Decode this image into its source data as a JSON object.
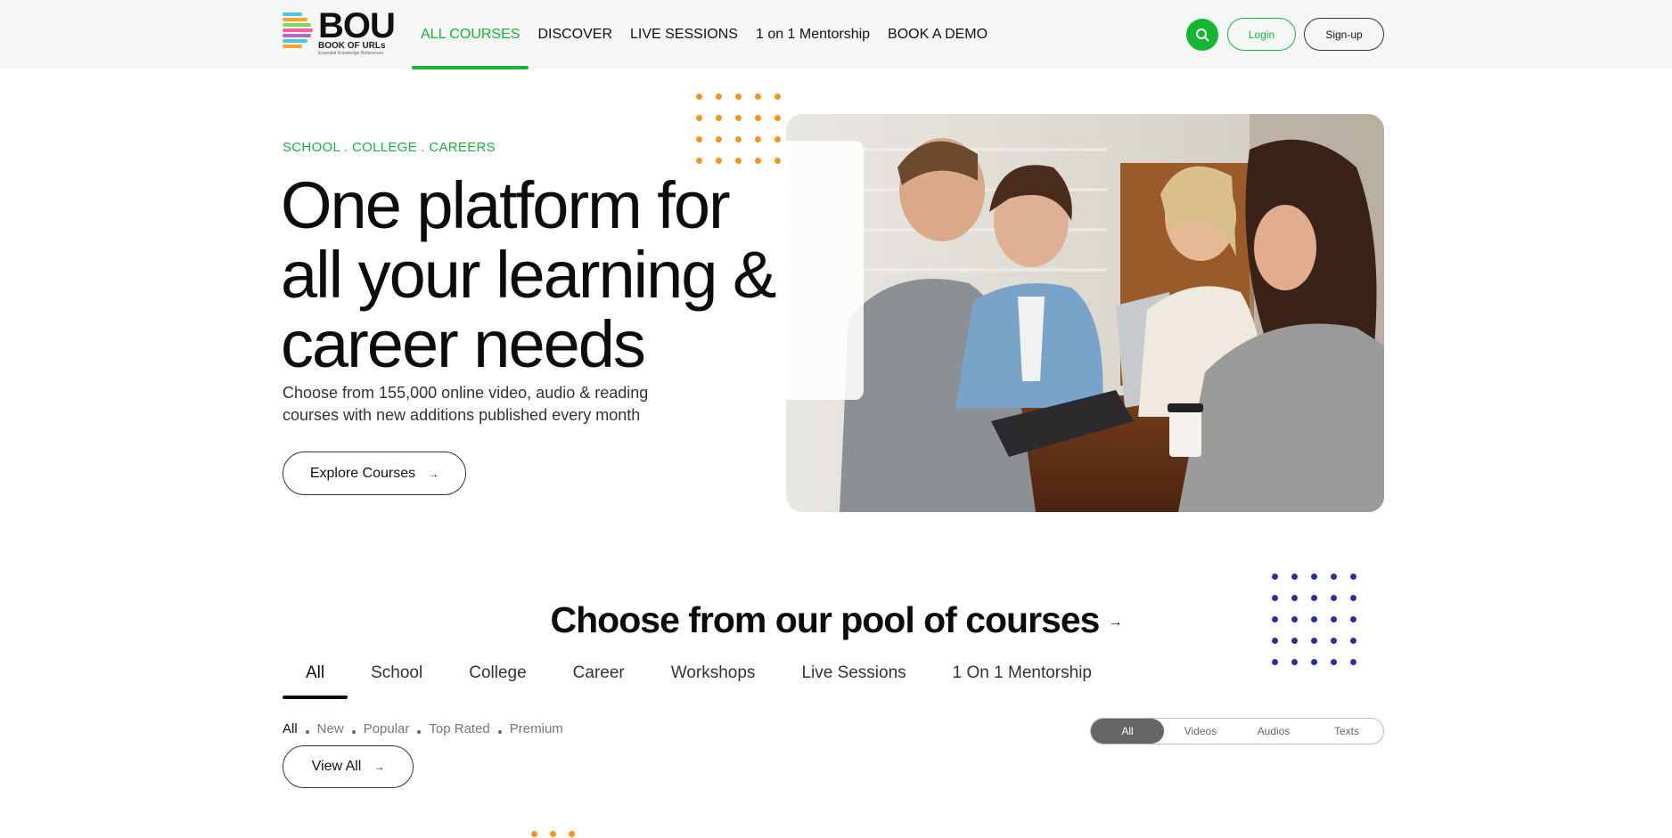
{
  "header": {
    "logo": {
      "main": "BOU",
      "sub": "BOOK OF URLs",
      "tagline": "Essential Knowledge References"
    },
    "nav": [
      {
        "label": "ALL COURSES",
        "active": true
      },
      {
        "label": "DISCOVER",
        "active": false
      },
      {
        "label": "LIVE SESSIONS",
        "active": false
      },
      {
        "label": "1 on 1 Mentorship",
        "active": false
      },
      {
        "label": "BOOK A DEMO",
        "active": false
      }
    ],
    "search_icon": "search-icon",
    "login_label": "Login",
    "signup_label": "Sign-up"
  },
  "hero": {
    "eyebrow": "SCHOOL . COLLEGE . CAREERS",
    "title_line1": "One platform for",
    "title_line2": "all your learning &",
    "title_line3": "career needs",
    "description": "Choose from 155,000 online video, audio & reading courses with new additions published every month",
    "cta_label": "Explore Courses",
    "cta_arrow": "→"
  },
  "courses": {
    "title": "Choose from our pool of courses",
    "title_arrow": "→",
    "tabs": [
      "All",
      "School",
      "College",
      "Career",
      "Workshops",
      "Live Sessions",
      "1 On 1 Mentorship"
    ],
    "active_tab": "All",
    "filters": [
      "All",
      "New",
      "Popular",
      "Top Rated",
      "Premium"
    ],
    "active_filter": "All",
    "view_all_label": "View All",
    "view_all_arrow": "→",
    "media_types": [
      "All",
      "Videos",
      "Audios",
      "Texts"
    ],
    "active_media": "All"
  },
  "colors": {
    "accent_green": "#1bb040",
    "search_green": "#14b634",
    "dots_orange": "#f7931e",
    "dots_blue": "#2c2fa0"
  }
}
